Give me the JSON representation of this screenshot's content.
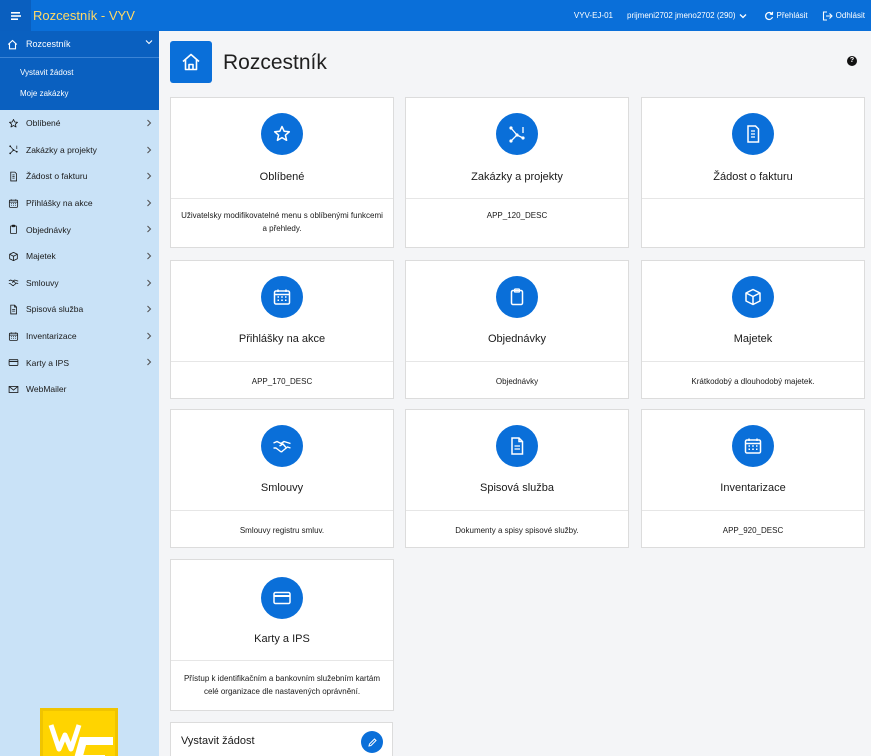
{
  "app": {
    "title": "Rozcestník - VYV"
  },
  "topbar": {
    "env": "VYV-EJ-01",
    "user": "prijmeni2702 jmeno2702 (290)",
    "overview_label": "Přehlásit",
    "logout_label": "Odhlásit"
  },
  "sidebar": {
    "active": {
      "label": "Rozcestník",
      "icon": "home-icon"
    },
    "sub_items": [
      "Vystavit žádost",
      "Moje zakázky"
    ],
    "items": [
      {
        "label": "Oblíbené",
        "icon": "star-icon",
        "chevron": true
      },
      {
        "label": "Zakázky a projekty",
        "icon": "nodes-icon",
        "chevron": true
      },
      {
        "label": "Žádost o fakturu",
        "icon": "invoice-icon",
        "chevron": true
      },
      {
        "label": "Přihlášky na akce",
        "icon": "calendar-icon",
        "chevron": true
      },
      {
        "label": "Objednávky",
        "icon": "clipboard-icon",
        "chevron": true
      },
      {
        "label": "Majetek",
        "icon": "box-icon",
        "chevron": true
      },
      {
        "label": "Smlouvy",
        "icon": "handshake-icon",
        "chevron": true
      },
      {
        "label": "Spisová služba",
        "icon": "document-icon",
        "chevron": true
      },
      {
        "label": "Inventarizace",
        "icon": "calendar-icon",
        "chevron": true
      },
      {
        "label": "Karty a IPS",
        "icon": "card-icon",
        "chevron": true
      },
      {
        "label": "WebMailer",
        "icon": "mail-icon",
        "chevron": false
      }
    ]
  },
  "page": {
    "title": "Rozcestník"
  },
  "cards": [
    {
      "title": "Oblíbené",
      "desc": "Uživatelsky modifikovatelné menu s oblíbenými funkcemi a přehledy.",
      "icon": "star-icon"
    },
    {
      "title": "Zakázky a projekty",
      "desc": "APP_120_DESC",
      "icon": "nodes-icon"
    },
    {
      "title": "Žádost o fakturu",
      "desc": "",
      "icon": "invoice-icon"
    },
    {
      "title": "Přihlášky na akce",
      "desc": "APP_170_DESC",
      "icon": "calendar-icon"
    },
    {
      "title": "Objednávky",
      "desc": "Objednávky",
      "icon": "clipboard-icon"
    },
    {
      "title": "Majetek",
      "desc": "Krátkodobý a dlouhodobý majetek.",
      "icon": "box-icon"
    },
    {
      "title": "Smlouvy",
      "desc": "Smlouvy registru smluv.",
      "icon": "handshake-icon"
    },
    {
      "title": "Spisová služba",
      "desc": "Dokumenty a spisy spisové služby.",
      "icon": "document-icon"
    },
    {
      "title": "Inventarizace",
      "desc": "APP_920_DESC",
      "icon": "calendar-icon"
    },
    {
      "title": "Karty a IPS",
      "desc": "Přístup k identifikačním a bankovním služebním kartám celé organizace dle nastavených oprávnění.",
      "icon": "card-icon"
    }
  ],
  "quick_action": {
    "title": "Vystavit žádost",
    "icon": "pencil-icon"
  },
  "colors": {
    "accent": "#0a6fd9",
    "sidebar_bg": "#c9e2f7",
    "title_yellow": "#ffd966"
  }
}
